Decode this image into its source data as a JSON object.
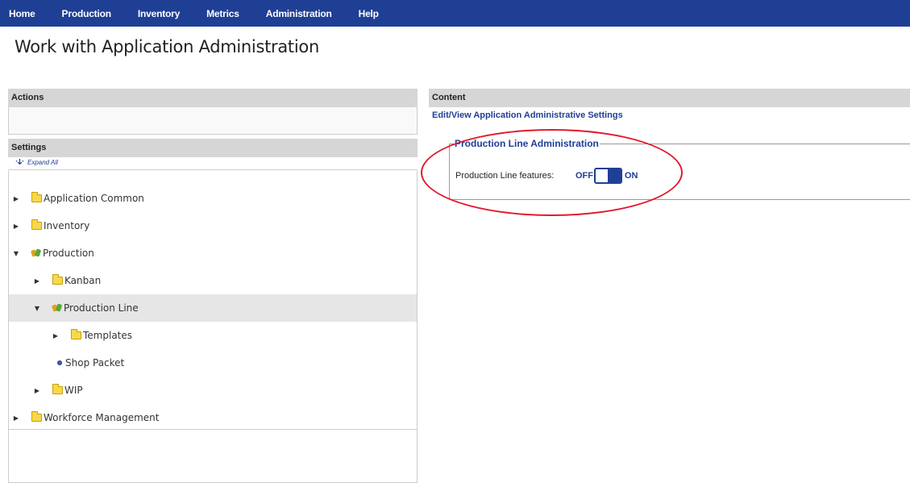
{
  "nav": {
    "items": [
      "Home",
      "Production",
      "Inventory",
      "Metrics",
      "Administration",
      "Help"
    ]
  },
  "page": {
    "title": "Work with Application Administration"
  },
  "actions": {
    "header": "Actions"
  },
  "settings": {
    "header": "Settings",
    "expand_all": "Expand All",
    "tree": [
      {
        "label": "Application Common",
        "icon": "folder-icon"
      },
      {
        "label": "Inventory",
        "icon": "folder-icon"
      },
      {
        "label": "Production",
        "icon": "gear-icon",
        "expanded": true
      },
      {
        "label": "Kanban",
        "icon": "folder-icon"
      },
      {
        "label": "Production Line",
        "icon": "gear-icon",
        "expanded": true,
        "selected": true
      },
      {
        "label": "Templates",
        "icon": "folder-icon"
      },
      {
        "label": "Shop Packet",
        "icon": "dot-icon"
      },
      {
        "label": "WIP",
        "icon": "folder-icon"
      },
      {
        "label": "Workforce Management",
        "icon": "folder-icon"
      }
    ]
  },
  "content": {
    "header": "Content",
    "subtitle": "Edit/View Application Administrative Settings",
    "fieldset_legend": "Production Line Administration",
    "feature_label": "Production Line features:",
    "off_label": "OFF",
    "on_label": "ON",
    "toggle_state": "ON"
  },
  "colors": {
    "nav_bg": "#1f3f95",
    "accent": "#1f3f95",
    "annotation": "#e3192d"
  }
}
